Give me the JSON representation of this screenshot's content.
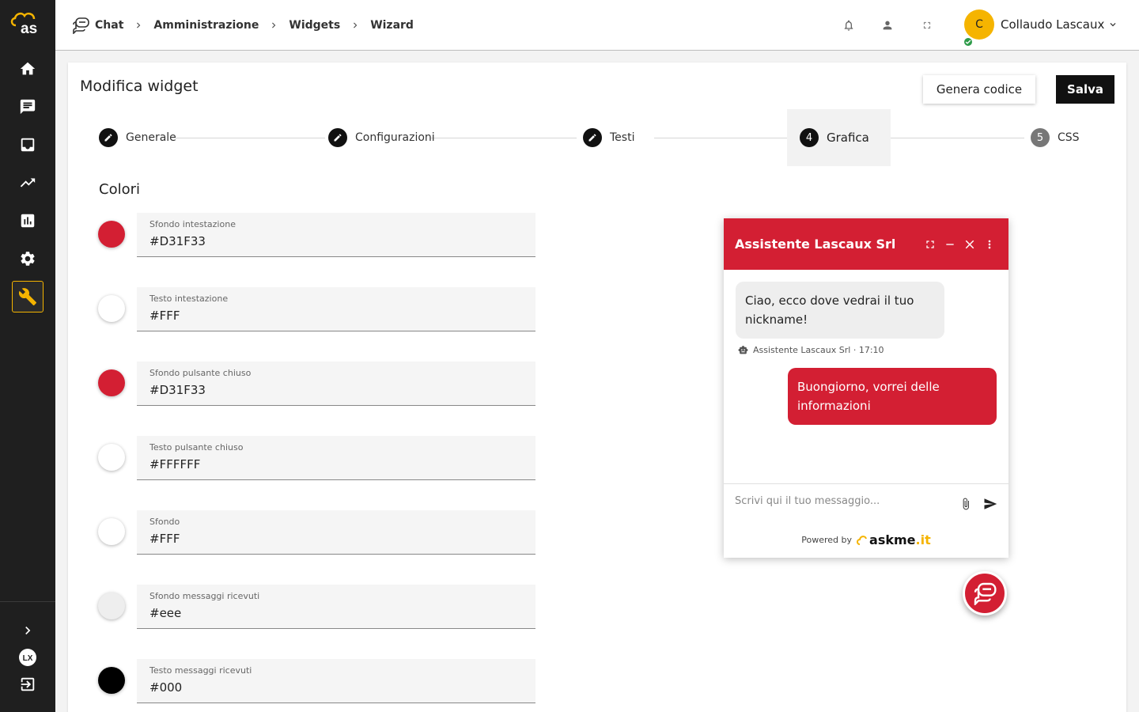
{
  "colors": {
    "brand": "#f5b400",
    "sidebar": "#1f1f1f",
    "widget_header": "#d31f33",
    "status_online": "#2e9b4a"
  },
  "sidebar": {
    "logo_text": "as",
    "items": [
      {
        "icon": "home-icon"
      },
      {
        "icon": "chat-icon"
      },
      {
        "icon": "inbox-icon"
      },
      {
        "icon": "trending-icon"
      },
      {
        "icon": "bar-chart-icon"
      },
      {
        "icon": "gear-icon"
      },
      {
        "icon": "wrench-icon",
        "active": true
      }
    ],
    "bottom": [
      {
        "icon": "chevron-right-icon"
      },
      {
        "icon": "lx-logo-icon",
        "text": "LX"
      },
      {
        "icon": "logout-icon"
      }
    ]
  },
  "header": {
    "breadcrumbs": [
      "Chat",
      "Amministrazione",
      "Widgets",
      "Wizard"
    ],
    "user": {
      "initial": "C",
      "name": "Collaudo Lascaux"
    }
  },
  "page": {
    "title": "Modifica widget",
    "generate_label": "Genera codice",
    "save_label": "Salva"
  },
  "steps": [
    {
      "label": "Generale",
      "state": "done"
    },
    {
      "label": "Configurazioni",
      "state": "done"
    },
    {
      "label": "Testi",
      "state": "done"
    },
    {
      "number": "4",
      "label": "Grafica",
      "state": "active"
    },
    {
      "number": "5",
      "label": "CSS",
      "state": "pending"
    }
  ],
  "section_title": "Colori",
  "color_fields": [
    {
      "label": "Sfondo intestazione",
      "value": "#D31F33",
      "swatch": "#d31f33"
    },
    {
      "label": "Testo intestazione",
      "value": "#FFF",
      "swatch": "#ffffff"
    },
    {
      "label": "Sfondo pulsante chiuso",
      "value": "#D31F33",
      "swatch": "#d31f33"
    },
    {
      "label": "Testo pulsante chiuso",
      "value": "#FFFFFF",
      "swatch": "#ffffff"
    },
    {
      "label": "Sfondo",
      "value": "#FFF",
      "swatch": "#ffffff"
    },
    {
      "label": "Sfondo messaggi ricevuti",
      "value": "#eee",
      "swatch": "#eeeeee"
    },
    {
      "label": "Testo messaggi ricevuti",
      "value": "#000",
      "swatch": "#000000"
    }
  ],
  "widget": {
    "title": "Assistente Lascaux Srl",
    "received_message": "Ciao, ecco dove vedrai il tuo nickname!",
    "message_meta": "Assistente Lascaux Srl · 17:10",
    "sent_message": "Buongiorno, vorrei delle informazioni",
    "input_placeholder": "Scrivi qui il tuo messaggio...",
    "powered_by": "Powered by",
    "brand_name": "askme",
    "brand_tld": ".it"
  }
}
